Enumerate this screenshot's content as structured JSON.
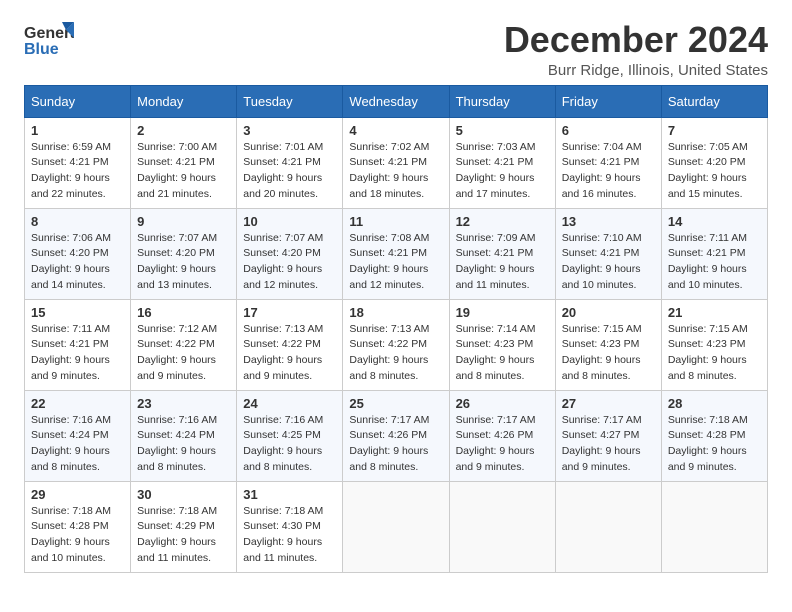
{
  "header": {
    "logo_general": "General",
    "logo_blue": "Blue",
    "title": "December 2024",
    "location": "Burr Ridge, Illinois, United States"
  },
  "calendar": {
    "days_of_week": [
      "Sunday",
      "Monday",
      "Tuesday",
      "Wednesday",
      "Thursday",
      "Friday",
      "Saturday"
    ],
    "weeks": [
      [
        {
          "day": "1",
          "sunrise": "6:59 AM",
          "sunset": "4:21 PM",
          "daylight": "9 hours and 22 minutes."
        },
        {
          "day": "2",
          "sunrise": "7:00 AM",
          "sunset": "4:21 PM",
          "daylight": "9 hours and 21 minutes."
        },
        {
          "day": "3",
          "sunrise": "7:01 AM",
          "sunset": "4:21 PM",
          "daylight": "9 hours and 20 minutes."
        },
        {
          "day": "4",
          "sunrise": "7:02 AM",
          "sunset": "4:21 PM",
          "daylight": "9 hours and 18 minutes."
        },
        {
          "day": "5",
          "sunrise": "7:03 AM",
          "sunset": "4:21 PM",
          "daylight": "9 hours and 17 minutes."
        },
        {
          "day": "6",
          "sunrise": "7:04 AM",
          "sunset": "4:21 PM",
          "daylight": "9 hours and 16 minutes."
        },
        {
          "day": "7",
          "sunrise": "7:05 AM",
          "sunset": "4:20 PM",
          "daylight": "9 hours and 15 minutes."
        }
      ],
      [
        {
          "day": "8",
          "sunrise": "7:06 AM",
          "sunset": "4:20 PM",
          "daylight": "9 hours and 14 minutes."
        },
        {
          "day": "9",
          "sunrise": "7:07 AM",
          "sunset": "4:20 PM",
          "daylight": "9 hours and 13 minutes."
        },
        {
          "day": "10",
          "sunrise": "7:07 AM",
          "sunset": "4:20 PM",
          "daylight": "9 hours and 12 minutes."
        },
        {
          "day": "11",
          "sunrise": "7:08 AM",
          "sunset": "4:21 PM",
          "daylight": "9 hours and 12 minutes."
        },
        {
          "day": "12",
          "sunrise": "7:09 AM",
          "sunset": "4:21 PM",
          "daylight": "9 hours and 11 minutes."
        },
        {
          "day": "13",
          "sunrise": "7:10 AM",
          "sunset": "4:21 PM",
          "daylight": "9 hours and 10 minutes."
        },
        {
          "day": "14",
          "sunrise": "7:11 AM",
          "sunset": "4:21 PM",
          "daylight": "9 hours and 10 minutes."
        }
      ],
      [
        {
          "day": "15",
          "sunrise": "7:11 AM",
          "sunset": "4:21 PM",
          "daylight": "9 hours and 9 minutes."
        },
        {
          "day": "16",
          "sunrise": "7:12 AM",
          "sunset": "4:22 PM",
          "daylight": "9 hours and 9 minutes."
        },
        {
          "day": "17",
          "sunrise": "7:13 AM",
          "sunset": "4:22 PM",
          "daylight": "9 hours and 9 minutes."
        },
        {
          "day": "18",
          "sunrise": "7:13 AM",
          "sunset": "4:22 PM",
          "daylight": "9 hours and 8 minutes."
        },
        {
          "day": "19",
          "sunrise": "7:14 AM",
          "sunset": "4:23 PM",
          "daylight": "9 hours and 8 minutes."
        },
        {
          "day": "20",
          "sunrise": "7:15 AM",
          "sunset": "4:23 PM",
          "daylight": "9 hours and 8 minutes."
        },
        {
          "day": "21",
          "sunrise": "7:15 AM",
          "sunset": "4:23 PM",
          "daylight": "9 hours and 8 minutes."
        }
      ],
      [
        {
          "day": "22",
          "sunrise": "7:16 AM",
          "sunset": "4:24 PM",
          "daylight": "9 hours and 8 minutes."
        },
        {
          "day": "23",
          "sunrise": "7:16 AM",
          "sunset": "4:24 PM",
          "daylight": "9 hours and 8 minutes."
        },
        {
          "day": "24",
          "sunrise": "7:16 AM",
          "sunset": "4:25 PM",
          "daylight": "9 hours and 8 minutes."
        },
        {
          "day": "25",
          "sunrise": "7:17 AM",
          "sunset": "4:26 PM",
          "daylight": "9 hours and 8 minutes."
        },
        {
          "day": "26",
          "sunrise": "7:17 AM",
          "sunset": "4:26 PM",
          "daylight": "9 hours and 9 minutes."
        },
        {
          "day": "27",
          "sunrise": "7:17 AM",
          "sunset": "4:27 PM",
          "daylight": "9 hours and 9 minutes."
        },
        {
          "day": "28",
          "sunrise": "7:18 AM",
          "sunset": "4:28 PM",
          "daylight": "9 hours and 9 minutes."
        }
      ],
      [
        {
          "day": "29",
          "sunrise": "7:18 AM",
          "sunset": "4:28 PM",
          "daylight": "9 hours and 10 minutes."
        },
        {
          "day": "30",
          "sunrise": "7:18 AM",
          "sunset": "4:29 PM",
          "daylight": "9 hours and 11 minutes."
        },
        {
          "day": "31",
          "sunrise": "7:18 AM",
          "sunset": "4:30 PM",
          "daylight": "9 hours and 11 minutes."
        },
        null,
        null,
        null,
        null
      ]
    ]
  }
}
